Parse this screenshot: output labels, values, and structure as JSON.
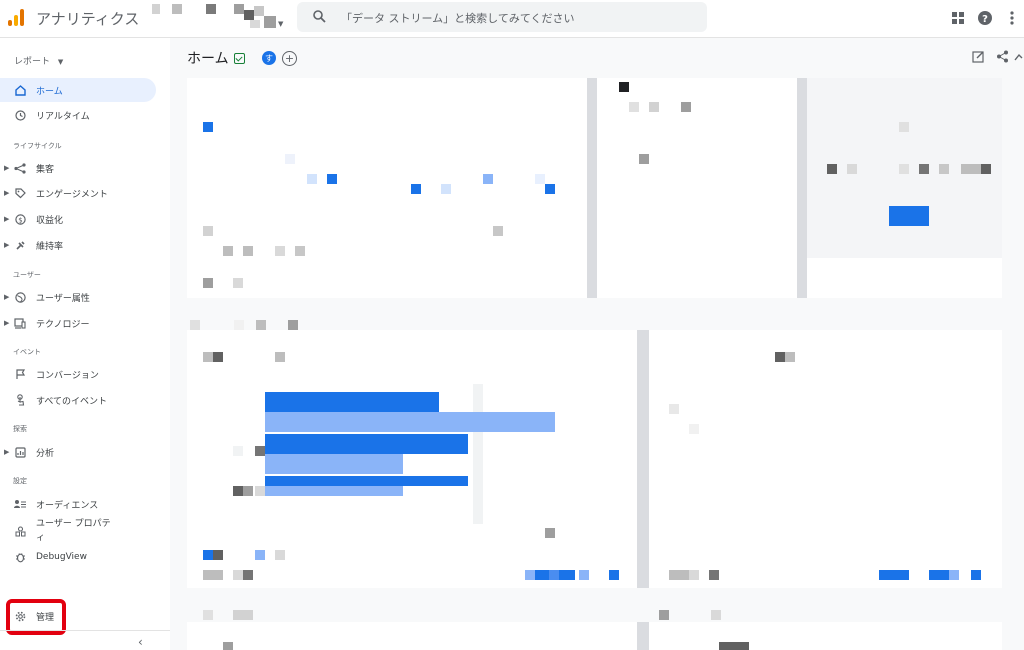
{
  "app": {
    "title": "アナリティクス"
  },
  "search": {
    "placeholder": "「データ ストリーム」と検索してみてください"
  },
  "sidebar": {
    "report_selector": "レポート",
    "items": [
      {
        "label": "ホーム",
        "icon": "home-icon",
        "active": true
      },
      {
        "label": "リアルタイム",
        "icon": "clock-icon"
      },
      {
        "label": "集客",
        "icon": "acquisition-icon",
        "expandable": true
      },
      {
        "label": "エンゲージメント",
        "icon": "tag-icon",
        "expandable": true
      },
      {
        "label": "収益化",
        "icon": "dollar-icon",
        "expandable": true
      },
      {
        "label": "維持率",
        "icon": "retention-icon",
        "expandable": true
      },
      {
        "label": "ユーザー属性",
        "icon": "globe-icon",
        "expandable": true
      },
      {
        "label": "テクノロジー",
        "icon": "devices-icon",
        "expandable": true
      },
      {
        "label": "コンバージョン",
        "icon": "flag-icon"
      },
      {
        "label": "すべてのイベント",
        "icon": "touch-icon"
      },
      {
        "label": "分析",
        "icon": "analysis-icon",
        "expandable": true
      },
      {
        "label": "オーディエンス",
        "icon": "audience-icon"
      },
      {
        "label": "ユーザー プロパティ",
        "icon": "user-property-icon"
      },
      {
        "label": "DebugView",
        "icon": "bug-icon"
      },
      {
        "label": "管理",
        "icon": "gear-icon"
      }
    ],
    "sections": [
      "ライフサイクル",
      "ユーザー",
      "イベント",
      "探索",
      "設定"
    ],
    "collapse": "‹"
  },
  "main": {
    "title": "ホーム",
    "avatar_letter": "す",
    "add_label": "+"
  },
  "colors": {
    "accent": "#1a73e8",
    "accent_light": "#8ab4f8",
    "highlight_box": "#e2000f"
  },
  "chart_data": {
    "type": "bar",
    "title": "",
    "categories": [
      "",
      "",
      ""
    ],
    "series": [
      {
        "values": [
          54,
          63,
          63
        ]
      },
      {
        "values": [
          90,
          43,
          43
        ]
      }
    ]
  }
}
